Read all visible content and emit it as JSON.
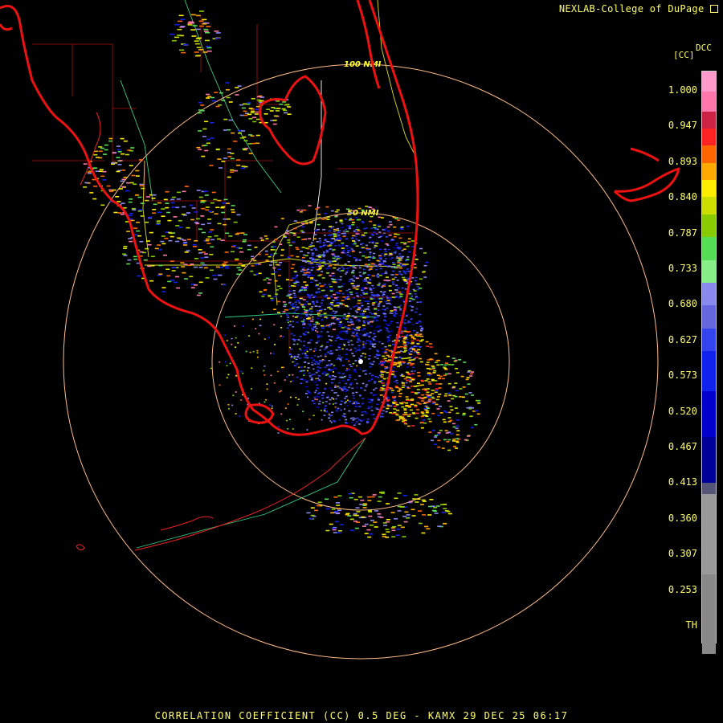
{
  "header": {
    "credit": "NEXLAB-College of DuPage"
  },
  "footer": {
    "title": "CORRELATION COEFFICIENT (CC) 0.5 DEG - KAMX 29 DEC 25 06:17"
  },
  "map": {
    "range_rings": [
      "100 NMI",
      "50 NMI"
    ]
  },
  "legend": {
    "product": "DCC",
    "unit": "[CC]",
    "ticks": [
      "1.000",
      "0.947",
      "0.893",
      "0.840",
      "0.787",
      "0.733",
      "0.680",
      "0.627",
      "0.573",
      "0.520",
      "0.467",
      "0.413",
      "0.360",
      "0.307",
      "0.253",
      "TH"
    ],
    "colors": [
      "#ff99cc",
      "#ff77aa",
      "#cc2244",
      "#ff2222",
      "#ff6600",
      "#ffaa00",
      "#ffee00",
      "#ccdd00",
      "#88cc00",
      "#55dd55",
      "#88ee88",
      "#8888ee",
      "#6666dd",
      "#3344ee",
      "#1122ee",
      "#0000cc",
      "#000099",
      "#555577",
      "#999999",
      "#888888",
      "#000000"
    ],
    "color_fractions": [
      0.035,
      0.035,
      0.03,
      0.03,
      0.03,
      0.03,
      0.03,
      0.03,
      0.04,
      0.04,
      0.04,
      0.04,
      0.04,
      0.04,
      0.07,
      0.08,
      0.08,
      0.02,
      0.14,
      0.14,
      0.02
    ]
  }
}
